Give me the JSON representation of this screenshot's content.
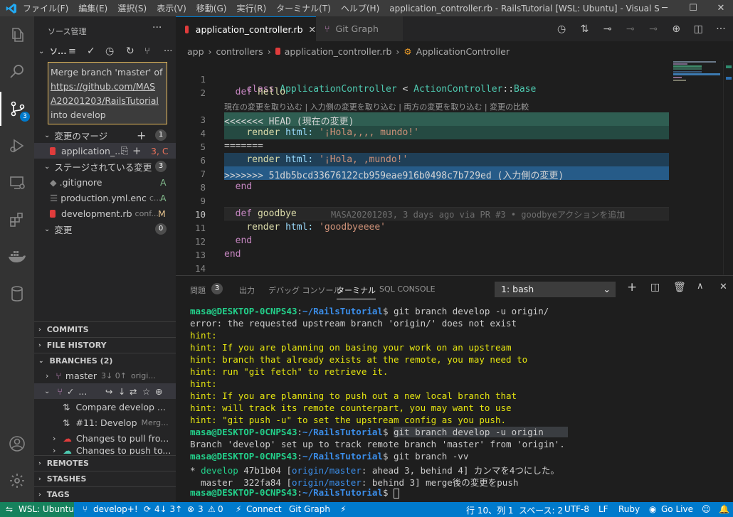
{
  "titlebar": {
    "menus": [
      "ファイル(F)",
      "編集(E)",
      "選択(S)",
      "表示(V)",
      "移動(G)",
      "実行(R)",
      "ターミナル(T)",
      "ヘルプ(H)"
    ],
    "title": "application_controller.rb - RailsTutorial [WSL: Ubuntu] - Visual Studi..."
  },
  "sidebar": {
    "header": "ソース管理",
    "scm_label": "ソ...",
    "commit_message": [
      "Merge branch 'master' of",
      "https://github.com/MAS",
      "A20201203/RailsTutorial",
      "into develop"
    ],
    "merge_group": {
      "label": "変更のマージ",
      "count": "1"
    },
    "merge_file": {
      "name": "application_...",
      "status": "3, C"
    },
    "staged_group": {
      "label": "ステージされている変更",
      "count": "3"
    },
    "staged_files": [
      {
        "name": ".gitignore",
        "dir": "",
        "status": "A"
      },
      {
        "name": "production.yml.enc",
        "dir": "c...",
        "status": "A"
      },
      {
        "name": "development.rb",
        "dir": "conf...",
        "status": "M"
      }
    ],
    "changes_group": {
      "label": "変更",
      "count": "0"
    },
    "sections": {
      "commits": "COMMITS",
      "file_history": "FILE HISTORY",
      "branches": "BRANCHES (2)",
      "remotes": "REMOTES",
      "stashes": "STASHES",
      "tags": "TAGS"
    },
    "branches": {
      "master": {
        "name": "master",
        "info": "3↓ 0↑",
        "remote": "origi..."
      },
      "develop": {
        "name": "..."
      },
      "compare": "Compare develop ...",
      "pr": "#11: Develop",
      "pr_sub": "Merg...",
      "pull": "Changes to pull fro...",
      "push": "Changes to push to..."
    }
  },
  "tabs": [
    {
      "label": "application_controller.rb"
    },
    {
      "label": "Git Graph"
    }
  ],
  "breadcrumb": [
    "app",
    "controllers",
    "application_controller.rb",
    "ApplicationController"
  ],
  "codelens": "現在の変更を取り込む | 入力側の変更を取り込む | 両方の変更を取り込む | 変更の比較",
  "code": [
    {
      "n": "1",
      "text": "class ApplicationController < ActionController::Base"
    },
    {
      "n": "2",
      "text": "  def hello"
    },
    {
      "n": "3",
      "text": "<<<<<<< HEAD (現在の変更)"
    },
    {
      "n": "4",
      "text": "    render html: '¡Hola,,,, mundo!'"
    },
    {
      "n": "5",
      "text": "======="
    },
    {
      "n": "6",
      "text": "    render html: '¡Hola, ,mundo!'"
    },
    {
      "n": "7",
      "text": ">>>>>>> 51db5bcd33676122cb959eae916b0498c7b729ed (入力側の変更)"
    },
    {
      "n": "8",
      "text": "  end"
    },
    {
      "n": "9",
      "text": ""
    },
    {
      "n": "10",
      "text": "  def goodbye"
    },
    {
      "n": "11",
      "text": "    render html: 'goodbyeeee'"
    },
    {
      "n": "12",
      "text": "  end"
    },
    {
      "n": "13",
      "text": "end"
    },
    {
      "n": "14",
      "text": ""
    }
  ],
  "blame": "MASA20201203, 3 days ago via PR #3 • goodbyeアクションを追加",
  "panel": {
    "tabs": [
      "問題",
      "出力",
      "デバッグ コンソール",
      "ターミナル",
      "SQL CONSOLE"
    ],
    "problems_count": "3",
    "terminal_select": "1: bash"
  },
  "terminal": {
    "prompt_user": "masa@DESKTOP-0CNPS43",
    "prompt_path": "~/RailsTutorial",
    "cmd1": "git branch develop -u origin/",
    "err1": "error: the requested upstream branch 'origin/' does not exist",
    "hints": [
      "hint:",
      "hint: If you are planning on basing your work on an upstream",
      "hint: branch that already exists at the remote, you may need to",
      "hint: run \"git fetch\" to retrieve it.",
      "hint:",
      "hint: If you are planning to push out a new local branch that",
      "hint: will track its remote counterpart, you may want to use",
      "hint: \"git push -u\" to set the upstream config as you push."
    ],
    "cmd2": "git branch develop -u origin",
    "out2": "Branch 'develop' set up to track remote branch 'master' from 'origin'.",
    "cmd3": "git branch -vv",
    "dev_line": {
      "star": "* ",
      "name": "develop",
      "hash": " 47b1b04 [",
      "remote": "origin/master",
      "rest": ": ahead 3, behind 4] カンマを4つにした。"
    },
    "mas_line": {
      "name": "  master  322fa84 [",
      "remote": "origin/master",
      "rest": ": behind 3] merge後の変更をpush"
    }
  },
  "status": {
    "remote": "WSL: Ubuntu",
    "branch": "develop+!",
    "sync": "4↓ 3↑",
    "problems": "3",
    "warnings": "0",
    "connect": "Connect",
    "gitgraph": "Git Graph",
    "position": "行 10、列 1",
    "spaces": "スペース: 2",
    "encoding": "UTF-8",
    "eol": "LF",
    "lang": "Ruby",
    "golive": "Go Live"
  },
  "colors": {
    "accent": "#007acc",
    "current_change": "#2f5e52",
    "incoming_change": "#1f4b6e"
  }
}
